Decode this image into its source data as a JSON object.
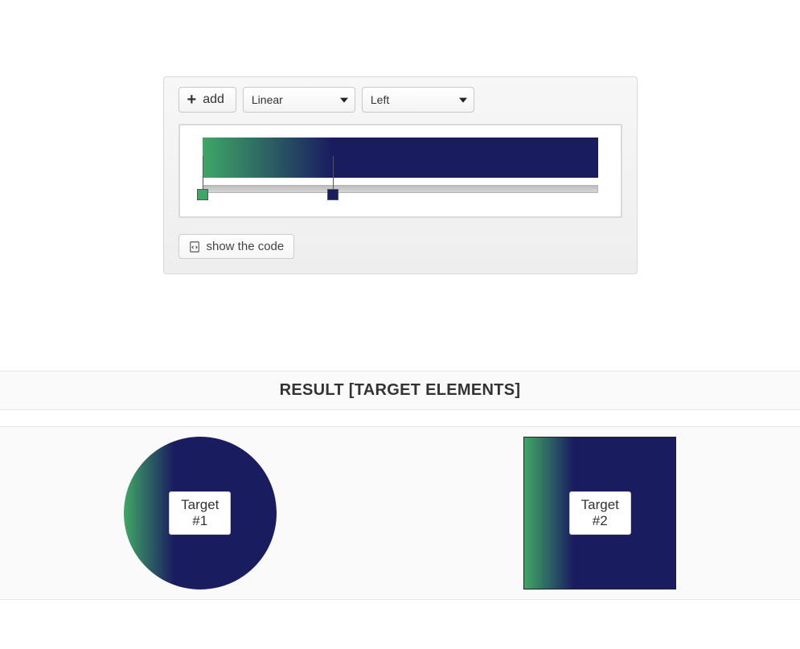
{
  "toolbar": {
    "add_label": "add",
    "type_select": "Linear",
    "direction_select": "Left",
    "show_code_label": "show the code"
  },
  "gradient": {
    "type": "linear",
    "direction": "left",
    "stops": [
      {
        "position_percent": 0,
        "color": "#3fa766"
      },
      {
        "position_percent": 33,
        "color": "#1a1c60"
      }
    ],
    "css": "linear-gradient(to right, #3fa766 0%, #1a1c60 33%, #1a1c60 100%)"
  },
  "result": {
    "heading": "RESULT [TARGET ELEMENTS]",
    "targets": [
      {
        "label_line1": "Target",
        "label_line2": "#1",
        "shape": "circle"
      },
      {
        "label_line1": "Target",
        "label_line2": "#2",
        "shape": "square"
      }
    ]
  }
}
